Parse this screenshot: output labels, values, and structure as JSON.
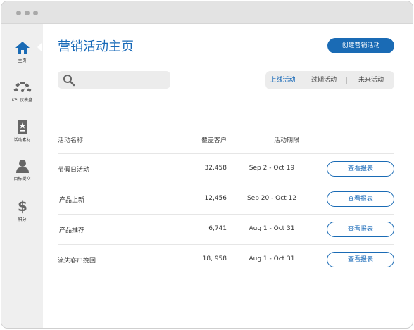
{
  "sidebar": {
    "items": [
      {
        "label": "主页",
        "icon": "home-icon"
      },
      {
        "label": "KPI 仪表盘",
        "icon": "gauge-icon"
      },
      {
        "label": "活动素材",
        "icon": "badge-icon"
      },
      {
        "label": "目标受众",
        "icon": "person-icon"
      },
      {
        "label": "积分",
        "icon": "dollar-icon"
      }
    ]
  },
  "header": {
    "title": "营销活动主页",
    "create_label": "创建营销活动"
  },
  "search": {
    "placeholder": "",
    "value": ""
  },
  "filters": {
    "tabs": [
      "上线活动",
      "过期活动",
      "未来活动"
    ],
    "active": "上线活动"
  },
  "table": {
    "columns": [
      "活动名称",
      "覆盖客户",
      "活动期限"
    ],
    "rows": [
      {
        "name": "节假日活动",
        "customers": "32,458",
        "period": "Sep 2 - Oct 19",
        "action": "查看报表"
      },
      {
        "name": "产品上新",
        "customers": "12,456",
        "period": "Sep 20 - Oct 12",
        "action": "查看报表"
      },
      {
        "name": "产品推荐",
        "customers": "6,741",
        "period": "Aug 1 - Oct 31",
        "action": "查看报表"
      },
      {
        "name": "流失客户挽回",
        "customers": "18, 958",
        "period": "Aug 1 - Oct 31",
        "action": "查看报表"
      }
    ]
  },
  "colors": {
    "accent": "#1a6bb5",
    "title": "#1769b8",
    "sidebar_bg": "#efefef",
    "icon": "#1a6bb5",
    "icon_muted": "#666666"
  }
}
